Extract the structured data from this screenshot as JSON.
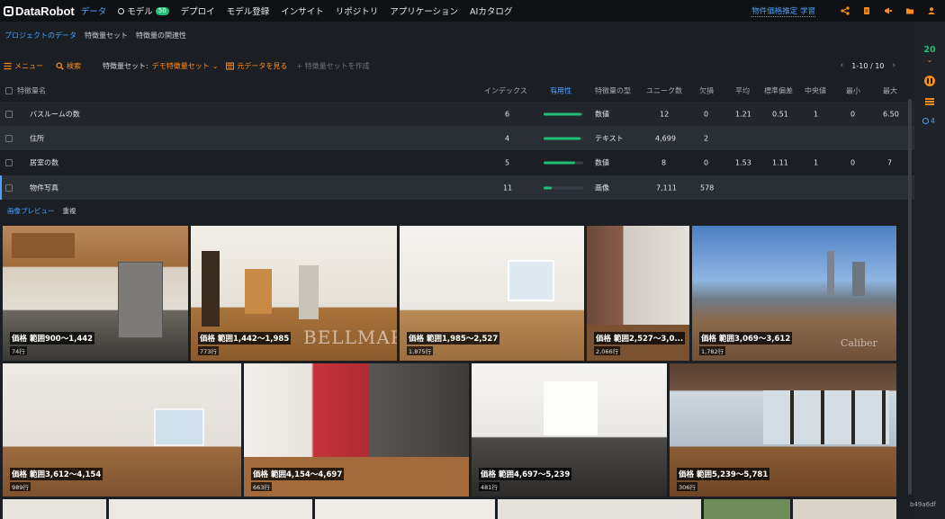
{
  "brand": "DataRobot",
  "nav": {
    "items": [
      {
        "label": "データ",
        "active": true
      },
      {
        "label": "モデル",
        "badge": "50"
      },
      {
        "label": "デプロイ"
      },
      {
        "label": "モデル登録"
      },
      {
        "label": "インサイト"
      },
      {
        "label": "リポジトリ"
      },
      {
        "label": "アプリケーション"
      },
      {
        "label": "AIカタログ"
      }
    ],
    "target_link": "物件価格推定 学習",
    "icons": [
      "share-icon",
      "document-icon",
      "megaphone-icon",
      "folder-icon",
      "user-icon"
    ]
  },
  "subnav": {
    "items": [
      "プロジェクトのデータ",
      "特徴量セット",
      "特徴量の関連性"
    ]
  },
  "toolbar": {
    "menu": "メニュー",
    "search": "検索",
    "feature_set_label": "特徴量セット:",
    "feature_set_value": "デモ特徴量セット",
    "view_raw": "元データを見る",
    "create_set": "+ 特徴量セットを作成",
    "pager": "1-10 / 10"
  },
  "table": {
    "headers": {
      "name": "特徴量名",
      "index": "インデックス",
      "importance": "有用性",
      "type": "特徴量の型",
      "unique": "ユニーク数",
      "missing": "欠損",
      "mean": "平均",
      "std": "標準偏差",
      "median": "中央値",
      "min": "最小",
      "max": "最大"
    },
    "rows": [
      {
        "name": "バスルームの数",
        "index": "6",
        "importance": 0.95,
        "type": "数値",
        "unique": "12",
        "missing": "0",
        "mean": "1.21",
        "std": "0.51",
        "median": "1",
        "min": "0",
        "max": "6.50"
      },
      {
        "name": "住所",
        "index": "4",
        "importance": 0.93,
        "type": "テキスト",
        "unique": "4,699",
        "missing": "2",
        "mean": "",
        "std": "",
        "median": "",
        "min": "",
        "max": ""
      },
      {
        "name": "居室の数",
        "index": "5",
        "importance": 0.8,
        "type": "数値",
        "unique": "8",
        "missing": "0",
        "mean": "1.53",
        "std": "1.11",
        "median": "1",
        "min": "0",
        "max": "7"
      },
      {
        "name": "物件写真",
        "index": "11",
        "importance": 0.2,
        "type": "画像",
        "unique": "7,111",
        "missing": "578",
        "mean": "",
        "std": "",
        "median": "",
        "min": "",
        "max": ""
      }
    ]
  },
  "preview": {
    "tabs": [
      "画像プレビュー",
      "重複"
    ],
    "tiles": [
      {
        "caption": "価格 範囲900〜1,442",
        "count": "74行"
      },
      {
        "caption": "価格 範囲1,442〜1,985",
        "count": "773行",
        "watermark": "BELLMARC"
      },
      {
        "caption": "価格 範囲1,985〜2,527",
        "count": "1,875行"
      },
      {
        "caption": "価格 範囲2,527〜3,0...",
        "count": "2,066行"
      },
      {
        "caption": "価格 範囲3,069〜3,612",
        "count": "1,782行",
        "watermark": "Caliber"
      },
      {
        "caption": "価格 範囲3,612〜4,154",
        "count": "989行"
      },
      {
        "caption": "価格 範囲4,154〜4,697",
        "count": "663行"
      },
      {
        "caption": "価格 範囲4,697〜5,239",
        "count": "481行"
      },
      {
        "caption": "価格 範囲5,239〜5,781",
        "count": "306行"
      }
    ]
  },
  "rail": {
    "count": "20",
    "workers": "4"
  },
  "build_id": "b49a6df",
  "colors": {
    "accent_blue": "#4aa3ff",
    "accent_orange": "#ff8c1a",
    "accent_green": "#1fbf75",
    "background": "#1b1e23"
  }
}
